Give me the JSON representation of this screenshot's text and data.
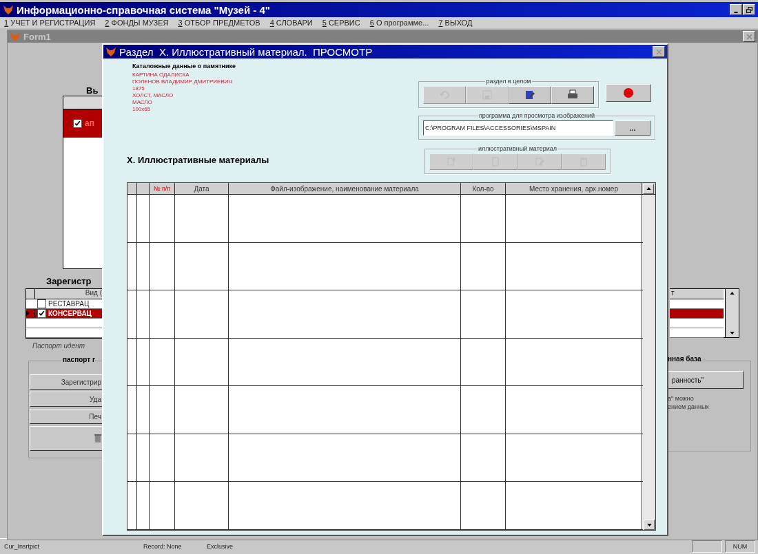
{
  "app": {
    "title": "Информационно-справочная система \"Музей - 4\""
  },
  "menu": [
    {
      "hotkey": "1",
      "label": "УЧЕТ И РЕГИСТРАЦИЯ"
    },
    {
      "hotkey": "2",
      "label": "ФОНДЫ МУЗЕЯ"
    },
    {
      "hotkey": "3",
      "label": "ОТБОР ПРЕДМЕТОВ"
    },
    {
      "hotkey": "4",
      "label": "СЛОВАРИ"
    },
    {
      "hotkey": "5",
      "label": "СЕРВИС"
    },
    {
      "hotkey": "6",
      "label": "О программе..."
    },
    {
      "hotkey": "7",
      "label": "ВЫХОД"
    }
  ],
  "form1": {
    "title": "Form1",
    "heading": "Вь",
    "top_rows": [
      {
        "checked": true,
        "selected": true,
        "text": "ап"
      }
    ],
    "reg_heading": "Зарегистр",
    "reg_column_1": "Вид (",
    "reg_column_2": "т",
    "reg_rows": [
      {
        "checked": false,
        "selected": false,
        "text": "РЕСТАВРАЦ"
      },
      {
        "checked": true,
        "selected": true,
        "text": "КОНСЕРВАЦ"
      }
    ],
    "note": "Паспорт идент",
    "group": "паспорт г",
    "buttons": [
      "Зарегистрир",
      "Уда",
      "Печ"
    ],
    "right_group": "нная база",
    "right_button": "ранность\"",
    "right_note": [
      "а\" можно",
      "ением данных"
    ]
  },
  "dialog": {
    "title": "Раздел  X. Иллюстративный материал.  ПРОСМОТР",
    "catalog_heading": "Каталожные данные о памятнике",
    "catalog": [
      "КАРТИНА ОДАЛИСКА",
      "ПОЛЕНОВ ВЛАДИМИР ДМИТРИЕВИЧ",
      "1875",
      "ХОЛСТ, МАСЛО",
      "МАСЛО",
      "100х65"
    ],
    "section_group": "раздел в целом",
    "section_buttons": [
      {
        "kind": "undo",
        "disabled": true
      },
      {
        "kind": "save",
        "disabled": true
      },
      {
        "kind": "edit",
        "disabled": false
      },
      {
        "kind": "print",
        "disabled": false
      }
    ],
    "viewer_group": "программа для просмотра изображений",
    "viewer_path": "C:\\PROGRAM FILES\\ACCESSORIES\\MSPAIN",
    "browse": "...",
    "heading": "X. Иллюстративные материалы",
    "material_group": "иллюстративный материал",
    "material_buttons": [
      {
        "kind": "add",
        "disabled": true
      },
      {
        "kind": "open",
        "disabled": true
      },
      {
        "kind": "edit",
        "disabled": true
      },
      {
        "kind": "delete",
        "disabled": true
      }
    ],
    "columns": [
      "№ п/п",
      "Дата",
      "Файл-изображение, наименование материала",
      "Кол-во",
      "Место хранения, арх.номер"
    ]
  },
  "status_bar": [
    "Cur_Insrtpict",
    "Record: None",
    "Exclusive"
  ],
  "status_num": "NUM"
}
